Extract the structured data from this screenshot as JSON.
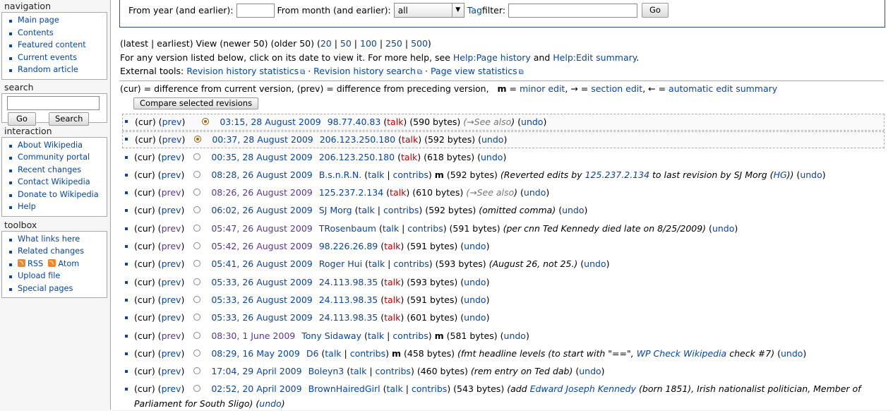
{
  "sidebar": {
    "navigation": {
      "title": "navigation",
      "items": [
        "Main page",
        "Contents",
        "Featured content",
        "Current events",
        "Random article"
      ]
    },
    "search": {
      "title": "search",
      "go": "Go",
      "search": "Search"
    },
    "interaction": {
      "title": "interaction",
      "items": [
        "About Wikipedia",
        "Community portal",
        "Recent changes",
        "Contact Wikipedia",
        "Donate to Wikipedia",
        "Help"
      ]
    },
    "toolbox": {
      "title": "toolbox",
      "items": [
        "What links here",
        "Related changes",
        "RSS",
        "Atom",
        "Upload file",
        "Special pages"
      ]
    }
  },
  "filter": {
    "year_label": "From year (and earlier):",
    "month_label": "From month (and earlier):",
    "month_value": "all",
    "tag_link": "Tag",
    "tag_label": " filter:",
    "go": "Go"
  },
  "paging": {
    "prefix": "(latest | earliest) View (newer 50) (older 50) (",
    "limits": [
      "20",
      "50",
      "100",
      "250",
      "500"
    ],
    "help_text": "For any version listed below, click on its date to view it. For more help, see ",
    "help_link1": "Help:Page history",
    "and": " and ",
    "help_link2": "Help:Edit summary",
    "ext_label": "External tools: ",
    "ext_links": [
      "Revision history statistics",
      "Revision history search",
      "Page view statistics"
    ]
  },
  "legend": {
    "a": "(cur) = difference from current version, (prev) = difference from preceding version,",
    "m": "m",
    "b": " = ",
    "minor": "minor edit",
    "c": ", → = ",
    "section": "section edit",
    "d": ", ← = ",
    "auto": "automatic edit summary"
  },
  "compare_button": "Compare selected revisions",
  "history": [
    {
      "date": "03:15, 28 August 2009",
      "user": "98.77.40.83",
      "talk": "talk",
      "contribs": "",
      "minor": "",
      "bytes": "(590 bytes)",
      "comment_pre": "(→",
      "comment": "See also",
      "comment_post": ")",
      "undo": "undo"
    },
    {
      "date": "00:37, 28 August 2009",
      "user": "206.123.250.180",
      "talk": "talk",
      "contribs": "",
      "minor": "",
      "bytes": "(592 bytes)",
      "comment_pre": "",
      "comment": "",
      "comment_post": "",
      "undo": "undo"
    },
    {
      "date": "00:35, 28 August 2009",
      "user": "206.123.250.180",
      "talk": "talk",
      "contribs": "",
      "minor": "",
      "bytes": "(618 bytes)",
      "comment_pre": "",
      "comment": "",
      "comment_post": "",
      "undo": "undo"
    },
    {
      "date": "08:28, 26 August 2009",
      "user": "B.s.n.R.N.",
      "talk": "talk",
      "contribs": "contribs",
      "minor": "m",
      "bytes": "(592 bytes)",
      "comment_pre": "(Reverted edits by ",
      "comment": "125.237.2.134",
      "comment_post": " to last revision by SJ Morg (",
      "hg": "HG",
      "undo": "undo"
    },
    {
      "date": "08:26, 26 August 2009",
      "user": "125.237.2.134",
      "talk": "talk",
      "contribs": "",
      "minor": "",
      "bytes": "(610 bytes)",
      "comment_pre": "(→",
      "comment": "See also",
      "comment_post": ")",
      "undo": "undo"
    },
    {
      "date": "06:02, 26 August 2009",
      "user": "SJ Morg",
      "talk": "talk",
      "contribs": "contribs",
      "minor": "",
      "bytes": "(592 bytes)",
      "comment_pre": "(omitted comma)",
      "comment": "",
      "comment_post": "",
      "undo": "undo"
    },
    {
      "date": "05:47, 26 August 2009",
      "user": "TRosenbaum",
      "talk": "talk",
      "contribs": "contribs",
      "minor": "",
      "bytes": "(591 bytes)",
      "comment_pre": "(per cnn Ted Kennedy died late on 8/25/2009)",
      "comment": "",
      "comment_post": "",
      "undo": "undo"
    },
    {
      "date": "05:42, 26 August 2009",
      "user": "98.226.26.89",
      "talk": "talk",
      "contribs": "",
      "minor": "",
      "bytes": "(591 bytes)",
      "comment_pre": "",
      "comment": "",
      "comment_post": "",
      "undo": "undo"
    },
    {
      "date": "05:41, 26 August 2009",
      "user": "Roger Hui",
      "talk": "talk",
      "contribs": "contribs",
      "minor": "",
      "bytes": "(593 bytes)",
      "comment_pre": "(August 26, not 25.)",
      "comment": "",
      "comment_post": "",
      "undo": "undo"
    },
    {
      "date": "05:33, 26 August 2009",
      "user": "24.113.98.35",
      "talk": "talk",
      "contribs": "",
      "minor": "",
      "bytes": "(593 bytes)",
      "comment_pre": "",
      "comment": "",
      "comment_post": "",
      "undo": "undo"
    },
    {
      "date": "05:33, 26 August 2009",
      "user": "24.113.98.35",
      "talk": "talk",
      "contribs": "",
      "minor": "",
      "bytes": "(591 bytes)",
      "comment_pre": "",
      "comment": "",
      "comment_post": "",
      "undo": "undo"
    },
    {
      "date": "05:33, 26 August 2009",
      "user": "24.113.98.35",
      "talk": "talk",
      "contribs": "",
      "minor": "",
      "bytes": "(601 bytes)",
      "comment_pre": "",
      "comment": "",
      "comment_post": "",
      "undo": "undo"
    },
    {
      "date": "08:30, 1 June 2009",
      "user": "Tony Sidaway",
      "talk": "talk",
      "contribs": "contribs",
      "minor": "m",
      "bytes": "(581 bytes)",
      "comment_pre": "",
      "comment": "",
      "comment_post": "",
      "undo": "undo"
    },
    {
      "date": "08:29, 16 May 2009",
      "user": "D6",
      "talk": "talk",
      "contribs": "contribs",
      "minor": "m",
      "bytes": "(458 bytes)",
      "comment_pre": "(fmt headline levels (to start with \"==\", ",
      "comment": "WP Check Wikipedia",
      "comment_post": " check #7)",
      "undo": "undo"
    },
    {
      "date": "17:04, 29 April 2009",
      "user": "Boleyn3",
      "talk": "talk",
      "contribs": "contribs",
      "minor": "",
      "bytes": "(460 bytes)",
      "comment_pre": "(rem entry on Ted dab)",
      "comment": "",
      "comment_post": "",
      "undo": "undo"
    },
    {
      "date": "02:52, 20 April 2009",
      "user": "BrownHairedGirl",
      "talk": "talk",
      "contribs": "contribs",
      "minor": "",
      "bytes": "(543 bytes)",
      "comment_pre": "(add ",
      "comment": "Edward Joseph Kennedy",
      "comment_post": " (born 1851), Irish nationalist politician, Member of",
      "comment_cont": "Parliament for South Sligo)",
      "undo": "undo"
    }
  ],
  "cur": "cur",
  "prev": "prev"
}
